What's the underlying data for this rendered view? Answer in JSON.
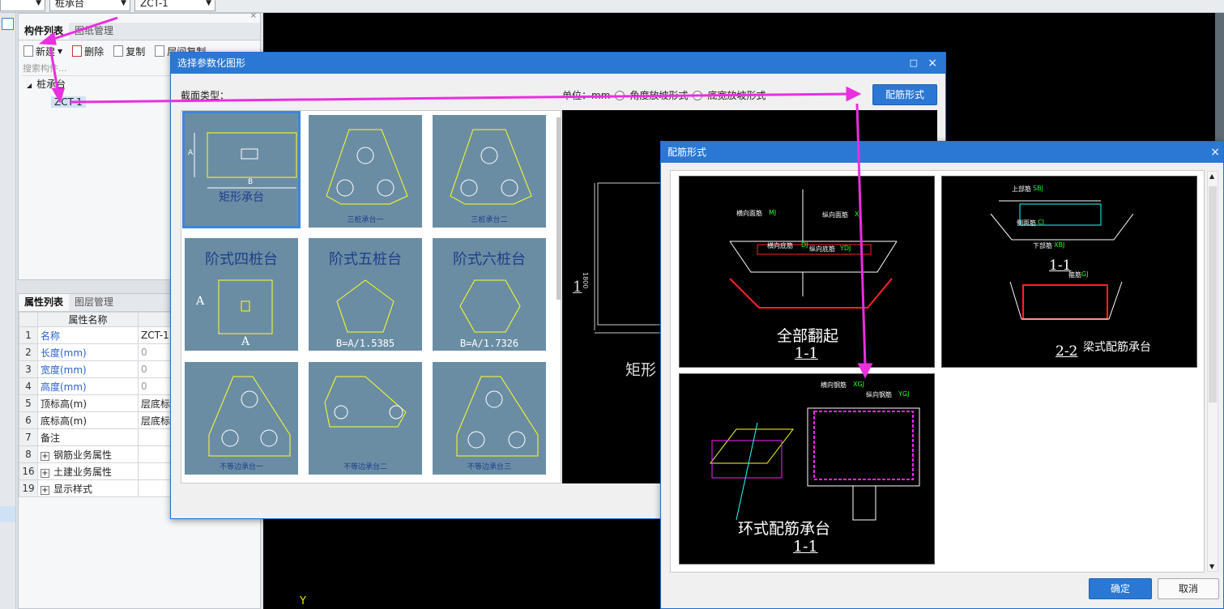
{
  "topbar": {
    "combo2": "桩承台",
    "combo3": "ZCT-1"
  },
  "left_panel": {
    "tabs": [
      "构件列表",
      "图纸管理"
    ],
    "toolbar": {
      "new": "新建",
      "delete": "删除",
      "copy": "复制",
      "floor_copy": "层间复制"
    },
    "search_placeholder": "搜索构件...",
    "tree": {
      "parent": "桩承台",
      "child": "ZCT-1"
    }
  },
  "prop_panel": {
    "tabs": [
      "属性列表",
      "图层管理"
    ],
    "header": "属性名称",
    "header2": "属",
    "rows": [
      {
        "n": "1",
        "name": "名称",
        "value": "ZCT-1",
        "blue": true,
        "gray": false
      },
      {
        "n": "2",
        "name": "长度(mm)",
        "value": "0",
        "blue": true,
        "gray": true
      },
      {
        "n": "3",
        "name": "宽度(mm)",
        "value": "0",
        "blue": true,
        "gray": true
      },
      {
        "n": "4",
        "name": "高度(mm)",
        "value": "0",
        "blue": true,
        "gray": true
      },
      {
        "n": "5",
        "name": "顶标高(m)",
        "value": "层底标高",
        "blue": false,
        "gray": false
      },
      {
        "n": "6",
        "name": "底标高(m)",
        "value": "层底标高",
        "blue": false,
        "gray": false
      },
      {
        "n": "7",
        "name": "备注",
        "value": "",
        "blue": false,
        "gray": false
      }
    ],
    "groups": [
      {
        "n": "8",
        "name": "钢筋业务属性"
      },
      {
        "n": "16",
        "name": "土建业务属性"
      },
      {
        "n": "19",
        "name": "显示样式"
      }
    ]
  },
  "dialog1": {
    "title": "选择参数化图形",
    "section_label": "截面类型：",
    "unit_label": "单位：mm",
    "radio1": "角度放坡形式",
    "radio2": "底宽放坡形式",
    "rebar_button": "配筋形式",
    "shapes": [
      {
        "label": "矩形承台",
        "style": "small-big"
      },
      {
        "label": "三桩承台一",
        "style": "tiny"
      },
      {
        "label": "三桩承台二",
        "style": "tiny"
      },
      {
        "label": "阶式四桩台",
        "style": "title"
      },
      {
        "label": "阶式五桩台",
        "style": "title"
      },
      {
        "label": "阶式六桩台",
        "style": "title"
      },
      {
        "label": "不等边承台一",
        "style": "tiny"
      },
      {
        "label": "不等边承台二",
        "style": "tiny"
      },
      {
        "label": "不等边承台三",
        "style": "tiny"
      }
    ],
    "formula5": "B=A/1.5385",
    "formula6": "B=A/1.7326",
    "dimA": "A",
    "dimB": "B",
    "preview": {
      "label": "矩形",
      "dim_left": "1",
      "dim_mid": "1800"
    }
  },
  "dialog2": {
    "title": "配筋形式",
    "ok": "确定",
    "cancel": "取消",
    "thumb1": {
      "title": "全部翻起",
      "sub": "1-1",
      "l1": "横向面筋",
      "l1c": "MJ",
      "l2": "纵向面筋",
      "l2c": "XJ",
      "l3": "横向底筋",
      "l3c": "DJ",
      "l4": "纵向底筋",
      "l4c": "YDJ"
    },
    "thumb2": {
      "sub1": "1-1",
      "sub2": "2-2",
      "title": "梁式配筋承台",
      "l1": "上部筋",
      "l1c": "SBJ",
      "l2": "侧面筋",
      "l2c": "CJ",
      "l3": "下部筋",
      "l3c": "XBJ",
      "l4": "箍筋",
      "l4c": "GJ"
    },
    "thumb3": {
      "title": "环式配筋承台",
      "sub": "1-1",
      "l1": "横向钢筋",
      "l1c": "XGJ",
      "l2": "纵向钢筋",
      "l2c": "YGJ"
    }
  },
  "cad": {
    "axis": "Y"
  },
  "colors": {
    "accent": "#2b78d4",
    "cell": "#6b8da4",
    "arrow": "#ea2ee0"
  }
}
